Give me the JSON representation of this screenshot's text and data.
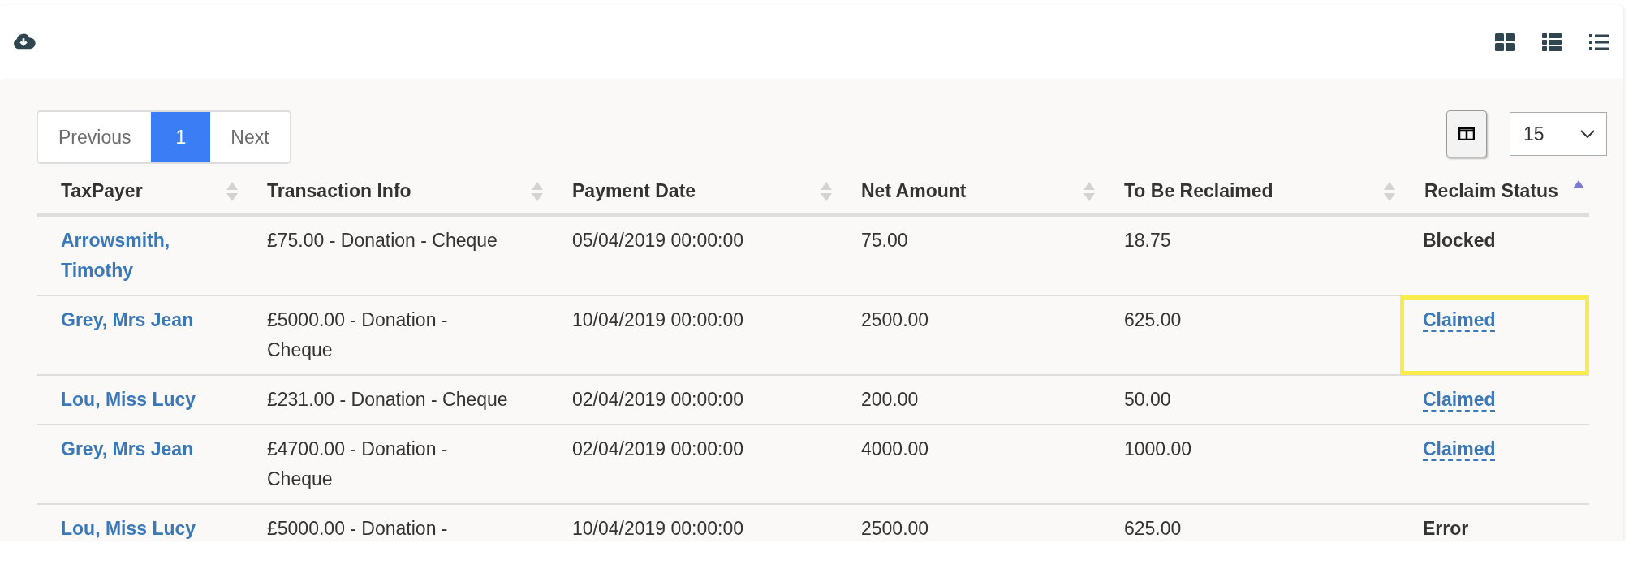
{
  "pagination": {
    "pages": [
      {
        "label": "Previous",
        "kind": "prev",
        "selected": false
      },
      {
        "label": "1",
        "kind": "page",
        "selected": true
      },
      {
        "label": "Next",
        "kind": "next",
        "selected": false
      }
    ]
  },
  "page_size": {
    "value": "15"
  },
  "table": {
    "columns": [
      {
        "label": "TaxPayer",
        "sorted_ascending": false
      },
      {
        "label": "Transaction Info",
        "sorted_ascending": false
      },
      {
        "label": "Payment Date",
        "sorted_ascending": false
      },
      {
        "label": "Net Amount",
        "sorted_ascending": false
      },
      {
        "label": "To Be Reclaimed",
        "sorted_ascending": false
      },
      {
        "label": "Reclaim Status",
        "sorted_ascending": true
      }
    ],
    "rows": [
      {
        "taxpayer": "Arrowsmith, Timothy",
        "transaction": "£75.00 - Donation - Cheque",
        "date": "05/04/2019 00:00:00",
        "net": "75.00",
        "reclaim": "18.75",
        "status": "Blocked",
        "status_is_link": false,
        "highlighted": false
      },
      {
        "taxpayer": "Grey, Mrs Jean",
        "transaction": "£5000.00 - Donation - Cheque",
        "date": "10/04/2019 00:00:00",
        "net": "2500.00",
        "reclaim": "625.00",
        "status": "Claimed",
        "status_is_link": true,
        "highlighted": true
      },
      {
        "taxpayer": "Lou, Miss Lucy",
        "transaction": "£231.00 - Donation - Cheque",
        "date": "02/04/2019 00:00:00",
        "net": "200.00",
        "reclaim": "50.00",
        "status": "Claimed",
        "status_is_link": true,
        "highlighted": false
      },
      {
        "taxpayer": "Grey, Mrs Jean",
        "transaction": "£4700.00 - Donation - Cheque",
        "date": "02/04/2019 00:00:00",
        "net": "4000.00",
        "reclaim": "1000.00",
        "status": "Claimed",
        "status_is_link": true,
        "highlighted": false
      },
      {
        "taxpayer": "Lou, Miss Lucy",
        "transaction": "£5000.00 - Donation -",
        "date": "10/04/2019 00:00:00",
        "net": "2500.00",
        "reclaim": "625.00",
        "status": "Error",
        "status_is_link": false,
        "highlighted": false
      }
    ]
  }
}
